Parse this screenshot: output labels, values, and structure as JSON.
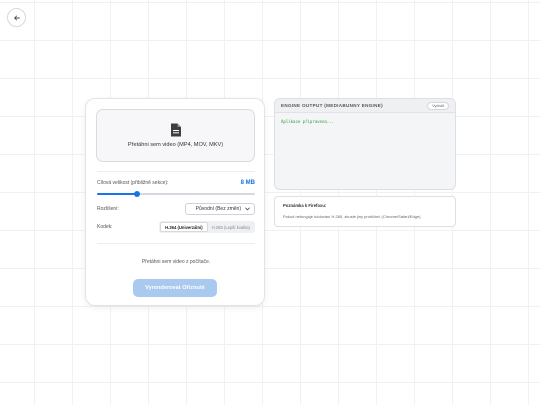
{
  "nav": {
    "back_icon": "arrow-left-icon"
  },
  "upload": {
    "drop_text": "Přetáhni sem video (MP4, MOV, MKV)",
    "icon": "file-icon"
  },
  "settings": {
    "target_size_label": "Cílová velikost (přibližně sekce):",
    "target_size_value": "8 MB",
    "slider_level": 0.25,
    "resolution_label": "Rozlišení:",
    "resolution_selected": "Původní (Bez změn)",
    "codec_label": "Kodek:",
    "codec_options": [
      "H.264 (Univerzální)",
      "H.265 (Lepší kvalita)"
    ],
    "codec_selected_index": 0
  },
  "status": {
    "text": "Přetáhni sem video z počítače."
  },
  "actions": {
    "render_label": "Vyrenderovat Oříznuté"
  },
  "console": {
    "title": "ENGINE OUTPUT (MEDIABUNNY ENGINE)",
    "clear_label": "Vyčistit",
    "lines": [
      "Aplikace připravena..."
    ]
  },
  "notice": {
    "title": "Poznámka k Firefoxu:",
    "text": "Pokud nefunguje kódování H.265, zkuste jiný prohlížeč (Chrome/Safari/Edge)."
  },
  "colors": {
    "accent": "#1a73e8",
    "button_disabled": "#a9c9ee",
    "console_text": "#2e9a3f"
  }
}
